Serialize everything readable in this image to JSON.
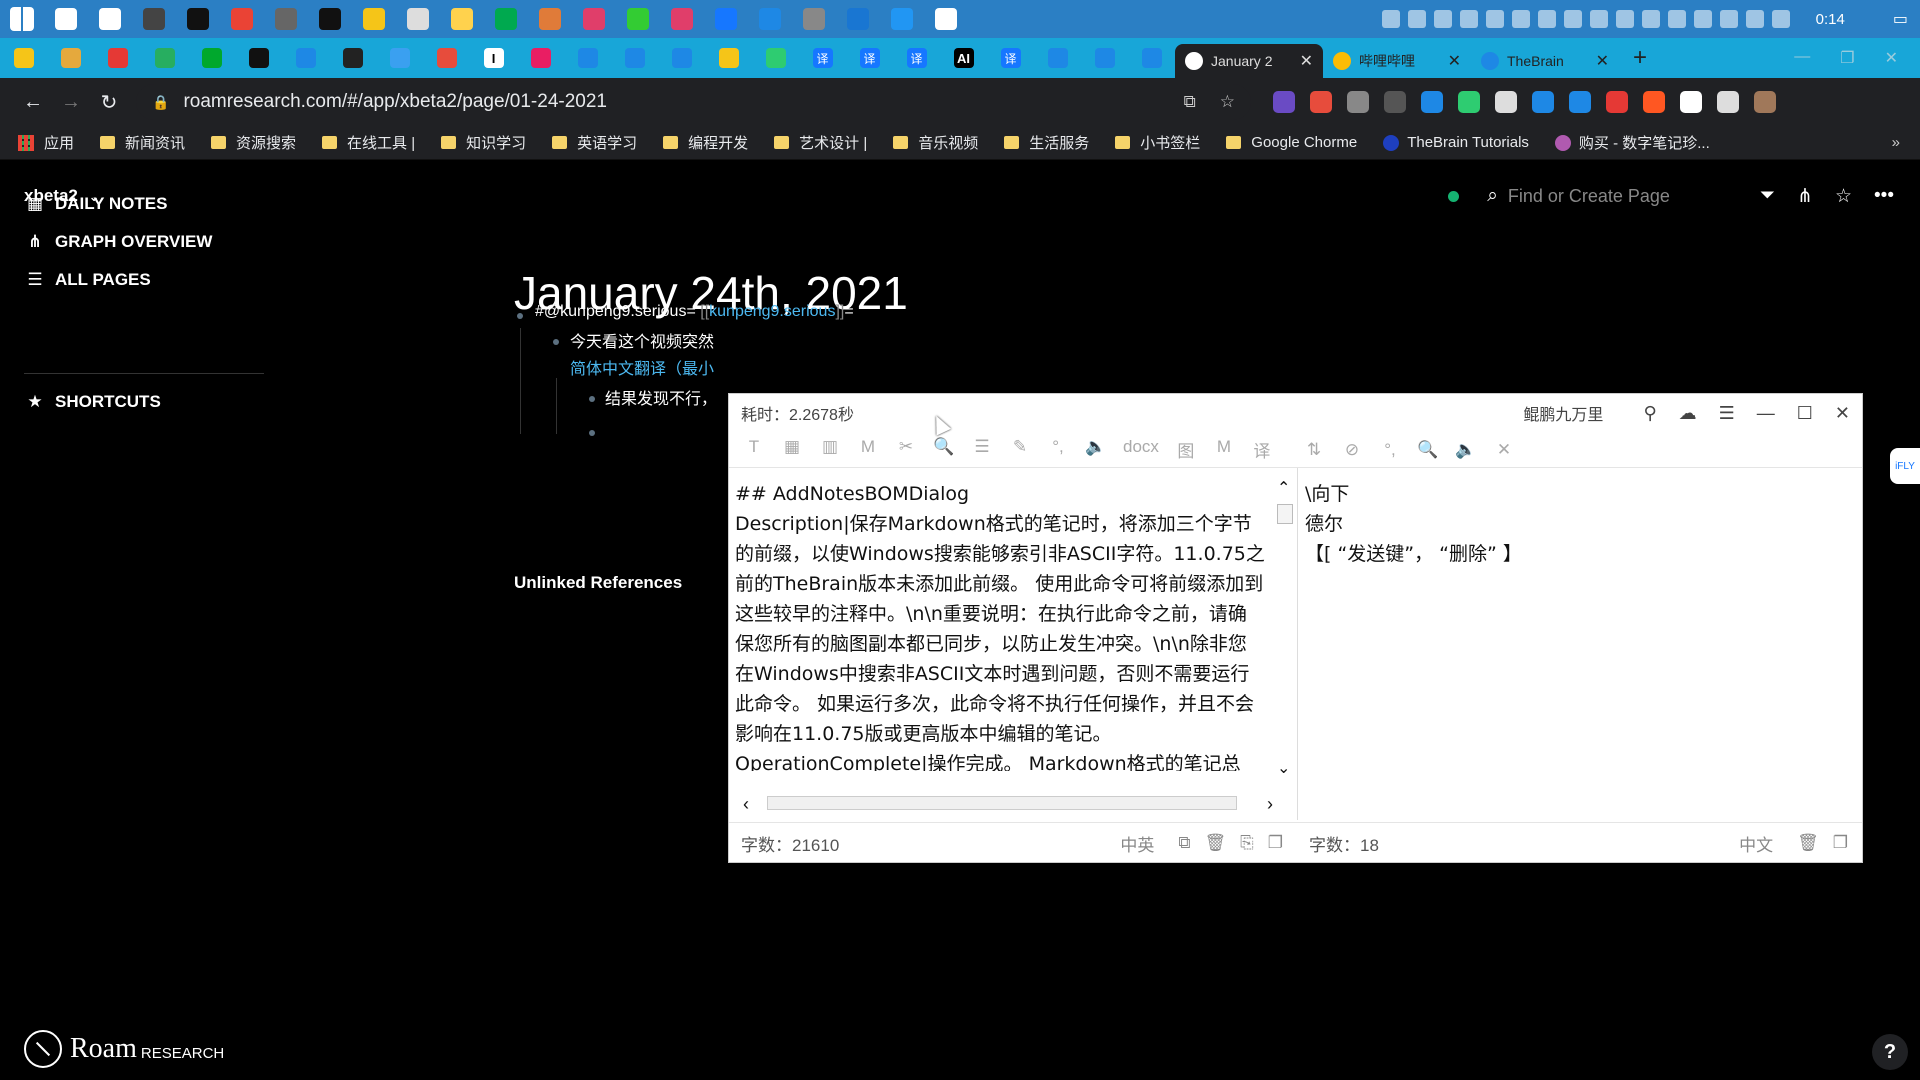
{
  "taskbar": {
    "clock": "0:14",
    "app_colors": [
      "#ffffff",
      "#ffffff",
      "#444",
      "#111",
      "#ea4335",
      "#666",
      "#111",
      "#f5c518",
      "#ddd",
      "#ffd24d",
      "#00a94f",
      "#e07b39",
      "#e03e6a",
      "#3c3",
      "#e03e6a",
      "#1677ff",
      "#1e88e5",
      "#888",
      "#1976d2",
      "#2196f3",
      "#fff"
    ]
  },
  "tabs": {
    "pinned": [
      {
        "icon": "check-icon",
        "color": "#f5c518",
        "text": ""
      },
      {
        "icon": "app-icon",
        "color": "#e5a93d",
        "text": ""
      },
      {
        "icon": "star-icon",
        "color": "#e53935",
        "text": ""
      },
      {
        "icon": "app-icon",
        "color": "#27ae60",
        "text": ""
      },
      {
        "icon": "evernote-icon",
        "color": "#00a82d",
        "text": ""
      },
      {
        "icon": "github-icon",
        "color": "#111111",
        "text": ""
      },
      {
        "icon": "grid-icon",
        "color": "#1e88e5",
        "text": ""
      },
      {
        "icon": "chart-icon",
        "color": "#222222",
        "text": ""
      },
      {
        "icon": "pen-icon",
        "color": "#3aa0f0",
        "text": ""
      },
      {
        "icon": "app-icon",
        "color": "#e74c3c",
        "text": ""
      },
      {
        "icon": "text-icon",
        "color": "#ffffff",
        "text": "I"
      },
      {
        "icon": "app-icon",
        "color": "#e91e63",
        "text": ""
      },
      {
        "icon": "app-icon",
        "color": "#1e88e5",
        "text": ""
      },
      {
        "icon": "app-icon",
        "color": "#1e88e5",
        "text": ""
      },
      {
        "icon": "app-icon",
        "color": "#1e88e5",
        "text": ""
      },
      {
        "icon": "app-icon",
        "color": "#f5c518",
        "text": ""
      },
      {
        "icon": "app-icon",
        "color": "#2ecc71",
        "text": ""
      },
      {
        "icon": "translate-icon",
        "color": "#1677ff",
        "text": "译"
      },
      {
        "icon": "translate-icon",
        "color": "#1677ff",
        "text": "译"
      },
      {
        "icon": "translate-icon",
        "color": "#1677ff",
        "text": "译"
      },
      {
        "icon": "ai-icon",
        "color": "#ffffff",
        "text": "AI"
      },
      {
        "icon": "translate-icon",
        "color": "#1677ff",
        "text": "译"
      },
      {
        "icon": "bolt-icon",
        "color": "#1e88e5",
        "text": ""
      },
      {
        "icon": "bolt-icon",
        "color": "#1e88e5",
        "text": ""
      },
      {
        "icon": "bolt-icon",
        "color": "#1e88e5",
        "text": ""
      }
    ],
    "open": [
      {
        "title": "January 2",
        "active": true,
        "fav_color": "#ffffff"
      },
      {
        "title": "哔哩哔哩",
        "active": false,
        "fav_color": "#fbbc05"
      },
      {
        "title": "TheBrain",
        "active": false,
        "fav_color": "#1e88e5"
      }
    ],
    "new_tab": "+"
  },
  "address": {
    "url": "roamresearch.com/#/app/xbeta2/page/01-24-2021",
    "ext_colors": [
      "#6a4bc4",
      "#e74c3c",
      "#888",
      "#555",
      "#1e88e5",
      "#2ecc71",
      "#ddd",
      "#1e88e5",
      "#1e88e5",
      "#e53935",
      "#ff5722",
      "#ffffff",
      "#ddd",
      "#a0785a"
    ]
  },
  "bookmarks": [
    {
      "label": "应用",
      "type": "apps"
    },
    {
      "label": "新闻资讯",
      "type": "folder"
    },
    {
      "label": "资源搜索",
      "type": "folder"
    },
    {
      "label": "在线工具 |",
      "type": "folder"
    },
    {
      "label": "知识学习",
      "type": "folder"
    },
    {
      "label": "英语学习",
      "type": "folder"
    },
    {
      "label": "编程开发",
      "type": "folder"
    },
    {
      "label": "艺术设计 |",
      "type": "folder"
    },
    {
      "label": "音乐视频",
      "type": "folder"
    },
    {
      "label": "生活服务",
      "type": "folder"
    },
    {
      "label": "小书签栏",
      "type": "folder"
    },
    {
      "label": "Google Chorme",
      "type": "folder"
    },
    {
      "label": "TheBrain Tutorials",
      "type": "link",
      "color": "#1e3fbf"
    },
    {
      "label": "购买 - 数字笔记珍...",
      "type": "link",
      "color": "#b05ab0"
    }
  ],
  "roam": {
    "graph_name": "xbeta2",
    "nav": [
      {
        "label": "DAILY NOTES",
        "icon": "calendar-icon"
      },
      {
        "label": "GRAPH OVERVIEW",
        "icon": "graph-icon"
      },
      {
        "label": "ALL PAGES",
        "icon": "list-icon"
      }
    ],
    "shortcuts_label": "SHORTCUTS",
    "search_placeholder": "Find or Create Page",
    "page_title": "January 24th, 2021",
    "block1_prefix": "#@kunpeng9.serious= ",
    "block1_ref": "kunpeng9.serious",
    "block1_suffix": "=",
    "block2_line1": "今天看这个视频突然",
    "block2_line2": "简体中文翻译（最小",
    "block3": "结果发现不行，",
    "unlinked_refs": "Unlinked References",
    "logo_big": "Roam",
    "logo_small": "RESEARCH",
    "help": "?",
    "edge_badge": "iFLY"
  },
  "translator": {
    "time_label": "耗时：2.2678秒",
    "app_name": "鲲鹏九万里",
    "tools_left": [
      "T",
      "▦",
      "▥",
      "M",
      "✂",
      "🔍",
      "☰",
      "✎",
      "°,",
      "🔈",
      "docx",
      "图",
      "M",
      "译"
    ],
    "tools_right": [
      "⇅",
      "⊘",
      "°,",
      "🔍",
      "🔈",
      "✕"
    ],
    "source_lines": [
      "## AddNotesBOMDialog",
      "Description|保存Markdown格式的笔记时，将添加三个字节的前缀，以使Windows搜索能够索引非ASCII字符。11.0.75之前的TheBrain版本未添加此前缀。 使用此命令可将前缀添加到这些较早的注释中。\\n\\n重要说明：在执行此命令之前，请确保您所有的脑图副本都已同步，以防止发生冲突。\\n\\n除非您在Windows中搜索非ASCII文本时遇到问题，否则不需要运行此命令。 如果运行多次，此命令将不执行任何操作，并且不会影响在11.0.75版或更高版本中编辑的笔记。",
      "OperationComplete|操作完成。 Markdown格式的笔记总"
    ],
    "output_lines": [
      "\\向下",
      "德尔",
      "【[ “发送键”， “删除” 】"
    ],
    "left_count": "字数：21610",
    "left_lang": "中英",
    "right_count": "字数：18",
    "right_lang": "中文"
  }
}
